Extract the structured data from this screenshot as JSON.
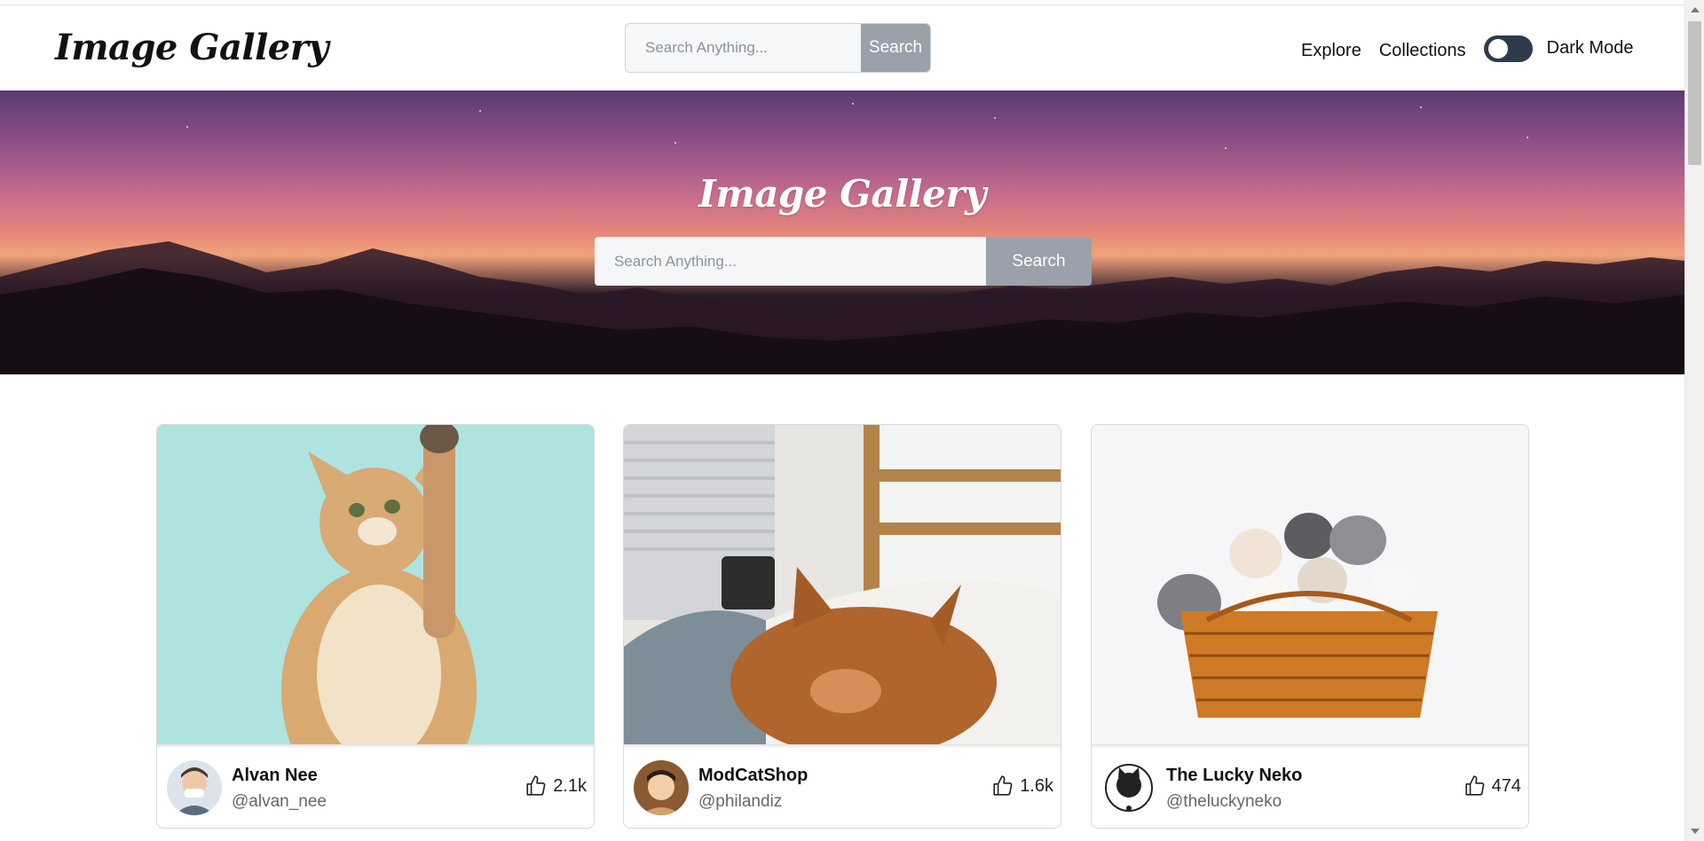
{
  "brand": "Image Gallery",
  "nav": {
    "search_placeholder": "Search Anything...",
    "search_button": "Search",
    "links": [
      "Explore",
      "Collections"
    ],
    "dark_mode_label": "Dark Mode",
    "dark_mode_on": false
  },
  "hero": {
    "title": "Image Gallery",
    "search_placeholder": "Search Anything...",
    "search_button": "Search"
  },
  "cards": [
    {
      "name": "Alvan Nee",
      "handle": "@alvan_nee",
      "likes": "2.1k",
      "photo": "kitten-reaching-up"
    },
    {
      "name": "ModCatShop",
      "handle": "@philandiz",
      "likes": "1.6k",
      "photo": "cat-sleeping-on-bed"
    },
    {
      "name": "The Lucky Neko",
      "handle": "@theluckyneko",
      "likes": "474",
      "photo": "kittens-in-basket"
    }
  ],
  "icons": {
    "like": "thumbs-up-icon"
  },
  "colors": {
    "button": "#9aa1aa",
    "toggle": "#2f3b4d"
  }
}
